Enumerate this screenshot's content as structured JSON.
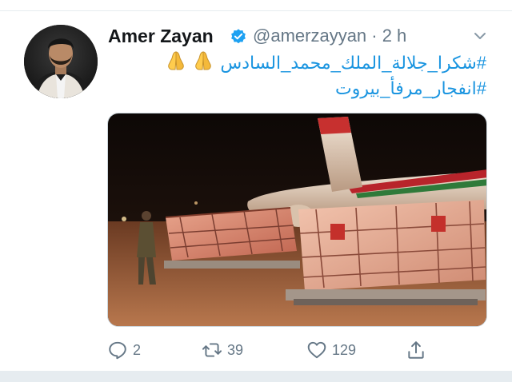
{
  "tweet": {
    "author_name": "Amer Zayan",
    "handle_time": "@amerzayyan · 2 h",
    "text_line1": "#شكرا_جلالة_الملك_محمد_السادس",
    "text_line2": "#انفجار_مرفأ_بيروت",
    "emoji": "folded-hands-emoji",
    "verified": true
  },
  "actions": {
    "reply_count": "2",
    "retweet_count": "39",
    "like_count": "129"
  },
  "icons": {
    "reply": "reply-icon",
    "retweet": "retweet-icon",
    "like": "heart-icon",
    "share": "share-icon",
    "menu": "chevron-down-icon"
  },
  "colors": {
    "link": "#1b95e0",
    "muted": "#657786",
    "verified": "#1da1f2",
    "divider": "#e6ecf0"
  }
}
